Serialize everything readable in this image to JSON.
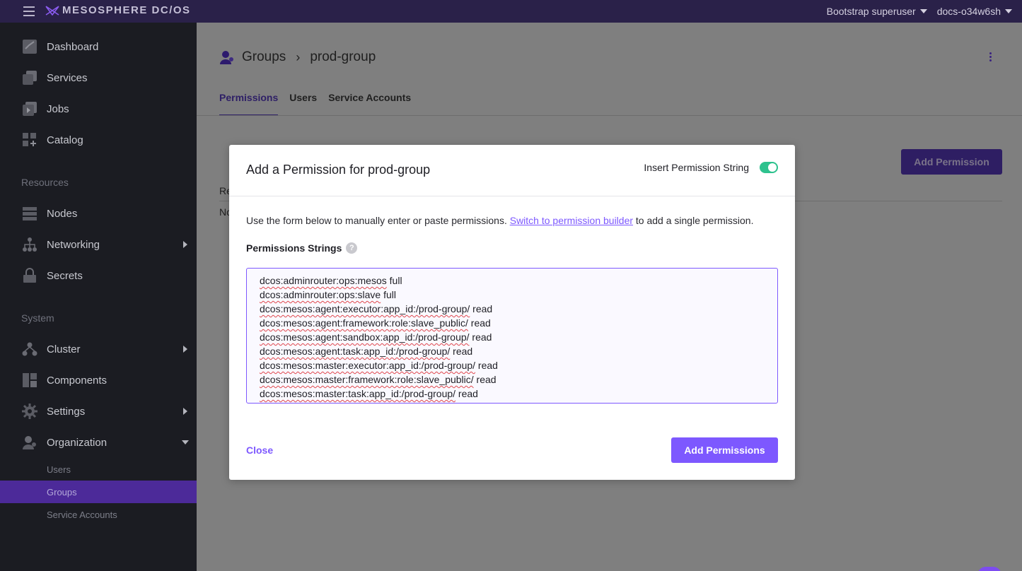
{
  "topbar": {
    "product": "MESOSPHERE DC/OS",
    "user_menu": "Bootstrap superuser",
    "cluster_menu": "docs-o34w6sh",
    "brand_color": "#2a2149"
  },
  "sidebar": {
    "primary": [
      {
        "label": "Dashboard",
        "icon": "dashboard-icon"
      },
      {
        "label": "Services",
        "icon": "services-icon"
      },
      {
        "label": "Jobs",
        "icon": "jobs-icon"
      },
      {
        "label": "Catalog",
        "icon": "catalog-icon"
      }
    ],
    "resources_title": "Resources",
    "resources": [
      {
        "label": "Nodes",
        "icon": "nodes-icon"
      },
      {
        "label": "Networking",
        "icon": "networking-icon"
      },
      {
        "label": "Secrets",
        "icon": "lock-icon"
      }
    ],
    "system_title": "System",
    "system": [
      {
        "label": "Cluster",
        "icon": "cluster-icon"
      },
      {
        "label": "Components",
        "icon": "components-icon"
      },
      {
        "label": "Settings",
        "icon": "gear-icon"
      },
      {
        "label": "Organization",
        "icon": "organization-icon"
      }
    ],
    "organization_sub": [
      {
        "label": "Users"
      },
      {
        "label": "Groups",
        "active": true
      },
      {
        "label": "Service Accounts"
      }
    ]
  },
  "page": {
    "breadcrumb_root": "Groups",
    "breadcrumb_current": "prod-group",
    "tabs": [
      "Permissions",
      "Users",
      "Service Accounts"
    ],
    "active_tab": "Permissions",
    "add_permission_label": "Add Permission",
    "column_fragment": "Re",
    "empty_fragment": "No"
  },
  "modal": {
    "title": "Add a Permission for prod-group",
    "toggle_label": "Insert Permission String",
    "toggle_on": true,
    "desc_before": "Use the form below to manually enter or paste permissions. ",
    "desc_link": "Switch to permission builder",
    "desc_after": " to add a single permission.",
    "field_label": "Permissions Strings",
    "help_glyph": "?",
    "permission_lines": [
      {
        "resource": "dcos:adminrouter:ops:mesos",
        "action": "full"
      },
      {
        "resource": "dcos:adminrouter:ops:slave",
        "action": "full"
      },
      {
        "resource": "dcos:mesos:agent:executor:app_id:/prod-group/",
        "action": "read"
      },
      {
        "resource": "dcos:mesos:agent:framework:role:slave_public/",
        "action": "read"
      },
      {
        "resource": "dcos:mesos:agent:sandbox:app_id:/prod-group/",
        "action": "read"
      },
      {
        "resource": "dcos:mesos:agent:task:app_id:/prod-group/",
        "action": "read"
      },
      {
        "resource": "dcos:mesos:master:executor:app_id:/prod-group/",
        "action": "read"
      },
      {
        "resource": "dcos:mesos:master:framework:role:slave_public/",
        "action": "read"
      },
      {
        "resource": "dcos:mesos:master:task:app_id:/prod-group/",
        "action": "read"
      }
    ],
    "close_label": "Close",
    "submit_label": "Add Permissions",
    "accent_color": "#7d58ff",
    "toggle_color": "#2ec28e"
  }
}
